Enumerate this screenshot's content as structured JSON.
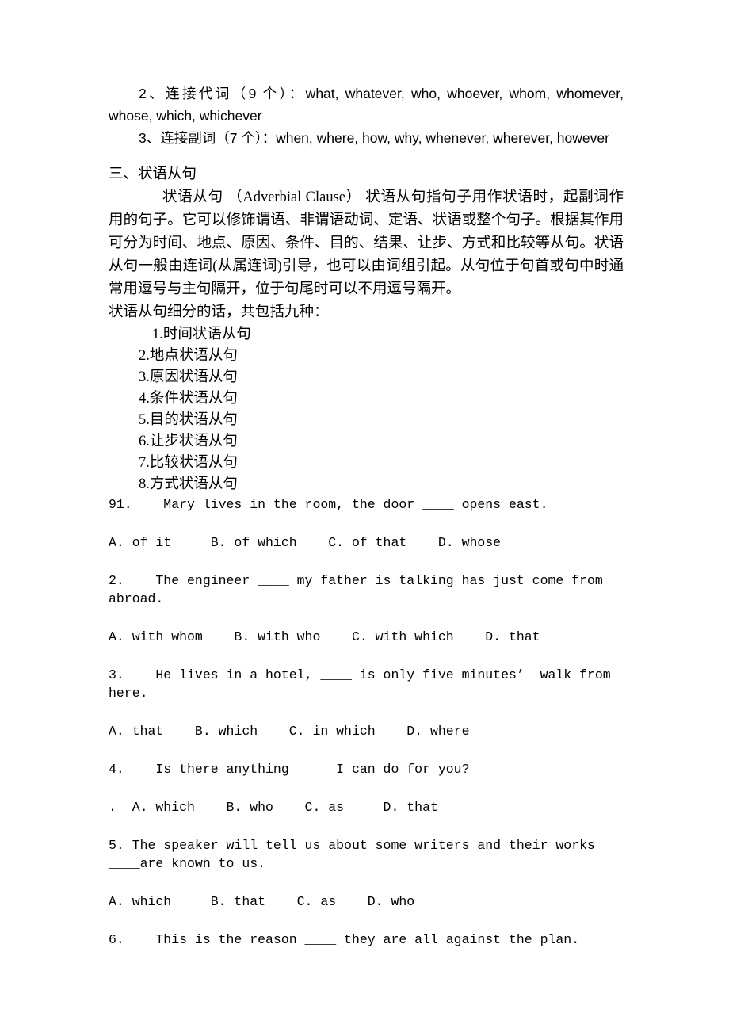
{
  "document": {
    "connective_pronouns_line": "2、连接代词（9 个）：what, whatever, who, whoever, whom, whomever, whose, which, whichever",
    "connective_adverbs_line": "3、连接副词（7 个）：when, where, how, why, whenever, wherever, however",
    "section_heading": "三、状语从句",
    "definition_paragraph": "状语从句 （Adverbial Clause） 状语从句指句子用作状语时，起副词作用的句子。它可以修饰谓语、非谓语动词、定语、状语或整个句子。根据其作用可分为时间、地点、原因、条件、目的、结果、让步、方式和比较等从句。状语从句一般由连词(从属连词)引导，也可以由词组引起。从句位于句首或句中时通常用逗号与主句隔开，位于句尾时可以不用逗号隔开。",
    "list_intro": "状语从句细分的话，共包括九种：",
    "clause_types": [
      "1.时间状语从句",
      "2.地点状语从句",
      "3.原因状语从句",
      "4.条件状语从句",
      "5.目的状语从句",
      "6.让步状语从句",
      "7.比较状语从句",
      "8.方式状语从句"
    ],
    "exercises": [
      {
        "stem": "91.    Mary lives in the room, the door ____ opens east.",
        "options": "A. of it     B. of which    C. of that    D. whose"
      },
      {
        "stem": "2.    The engineer ____ my father is talking has just come from abroad.",
        "options": "A. with whom    B. with who    C. with which    D. that"
      },
      {
        "stem": "3.    He lives in a hotel, ____ is only five minutes’  walk from here.",
        "options": "A. that    B. which    C. in which    D. where"
      },
      {
        "stem": "4.    Is there anything ____ I can do for you?",
        "options": ".  A. which    B. who    C. as     D. that"
      },
      {
        "stem": "5. The speaker will tell us about some writers and their works ____are known to us.",
        "options": "A. which     B. that    C. as    D. who"
      },
      {
        "stem": "6.    This is the reason ____ they are all against the plan.",
        "options": ""
      }
    ]
  }
}
